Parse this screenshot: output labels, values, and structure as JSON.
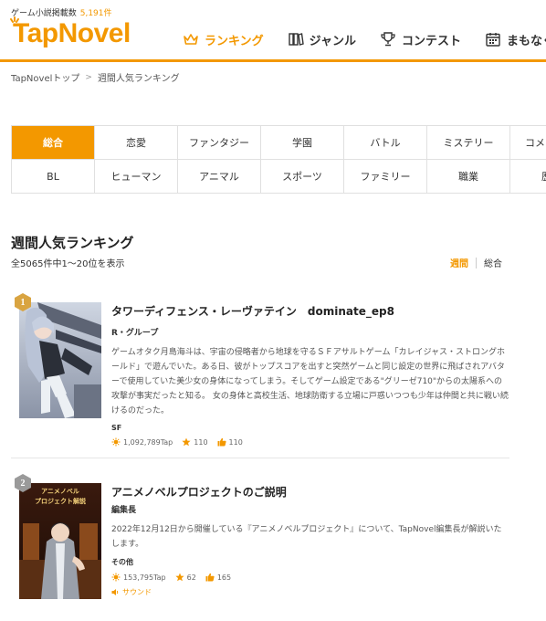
{
  "header": {
    "count_label": "ゲーム小説掲載数",
    "count_value": "5,191件",
    "logo_text": "TapNovel",
    "nav": [
      {
        "label": "ランキング",
        "icon": "crown-icon",
        "active": true
      },
      {
        "label": "ジャンル",
        "icon": "books-icon",
        "active": false
      },
      {
        "label": "コンテスト",
        "icon": "trophy-icon",
        "active": false
      },
      {
        "label": "まもなく",
        "icon": "calendar-icon",
        "active": false
      }
    ]
  },
  "breadcrumb": {
    "home": "TapNovelトップ",
    "current": "週間人気ランキング"
  },
  "genres": {
    "row1": [
      "総合",
      "恋愛",
      "ファンタジー",
      "学園",
      "バトル",
      "ミステリー",
      "コメ"
    ],
    "row2": [
      "BL",
      "ヒューマン",
      "アニマル",
      "スポーツ",
      "ファミリー",
      "職業",
      "歴"
    ]
  },
  "ranking": {
    "title": "週間人気ランキング",
    "result_count": "全5065件中1～20位を表示",
    "period_weekly": "週間",
    "period_overall": "総合"
  },
  "entries": [
    {
      "rank": "1",
      "title": "タワーディフェンス・レーヴァテイン　dominate_ep8",
      "author": "R・グループ",
      "description": "ゲームオタク月島海斗は、宇宙の侵略者から地球を守るＳＦアサルトゲーム「カレイジャス・ストロングホールド」で遊んでいた。ある日、彼がトップスコアを出すと突然ゲームと同じ設定の世界に飛ばされアバターで使用していた美少女の身体になってしまう。そしてゲーム設定である\"グリーゼ710\"からの太陽系への攻撃が事実だったと知る。 女の身体と高校生活、地球防衛する立場に戸惑いつつも少年は仲間と共に戦い続けるのだった。",
      "genre": "SF",
      "taps": "1,092,789Tap",
      "stars": "110",
      "likes": "110"
    },
    {
      "rank": "2",
      "title": "アニメノベルプロジェクトのご説明",
      "author": "編集長",
      "thumb_caption_1": "アニメノベル",
      "thumb_caption_2": "プロジェクト解説",
      "description": "2022年12月12日から開催している『アニメノベルプロジェクト』について、TapNovel編集長が解説いたします。",
      "genre": "その他",
      "taps": "153,795Tap",
      "stars": "62",
      "likes": "165",
      "sound": "サウンド"
    }
  ],
  "colors": {
    "brand": "#f39800",
    "rank1": "#d9a441",
    "rank2": "#9a9a9a"
  }
}
